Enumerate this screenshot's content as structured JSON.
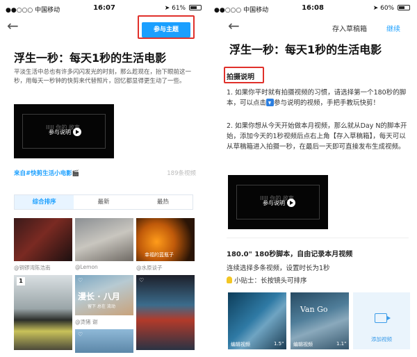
{
  "left": {
    "status": {
      "carrier": "●●○○○ 中国移动",
      "time": "16:07",
      "battery": "61%",
      "battery_level": 0.61
    },
    "nav": {
      "join_label": "参与主题"
    },
    "title": "浮生一秒：每天1秒的生活电影",
    "description": "平淡生活中总也有许多闪闪发光的时刻，那么趁现在，抬下眼前这一秒，用每天一秒钟的快剪来代替照片，回忆都显得更生动了一些。",
    "video": {
      "ghost_text": "IIIII 你的 故事",
      "button_label": "参与说明"
    },
    "source": "来自#快剪生活小电影🎬",
    "count": "189条视频",
    "tabs": [
      {
        "label": "综合排序",
        "active": true
      },
      {
        "label": "最新",
        "active": false
      },
      {
        "label": "最热",
        "active": false
      }
    ],
    "thumbs": {
      "row1_captions": [
        "@铜锣湾陈浩南",
        "@Lemon",
        "@水原谈子"
      ],
      "thumb3_overlay": "幸福的蓝瓶子",
      "thumb4_badge": "1",
      "thumb5_text": "漫长 · 八月",
      "thumb5_sub": "留下 总在 流动",
      "row2_captions": [
        "",
        "@烫猪 谢",
        ""
      ]
    }
  },
  "right": {
    "status": {
      "carrier": "●●○○○ 中国移动",
      "time": "16:08",
      "battery": "60%",
      "battery_level": 0.6
    },
    "nav": {
      "save_draft": "存入草稿箱",
      "continue": "继续"
    },
    "title": "浮生一秒：每天1秒的生活电影",
    "heading": "拍摄说明",
    "step1_a": "1. 如果你平时就有拍摄视频的习惯，请选择第一个180秒的脚本，可以点击",
    "step1_b": "参与说明的视频，手把手教玩快剪！",
    "step2": "2. 如果你想从今天开始做本月视频，那么就从Day N的脚本开始，添加今天的1秒视频后点右上角【存入草稿箱】，每天可以从草稿箱进入拍摄一秒，在最后一天即可直接发布生成视频。",
    "video": {
      "ghost_text": "IIIII 你的 故事",
      "button_label": "参与说明"
    },
    "script_title": "180.0\" 180秒脚本，自由记录本月视频",
    "script_desc": "连续选择多条视频，设置时长为1秒",
    "tip": "小贴士：长按镜头可排序",
    "clips": [
      {
        "label": "编辑视频",
        "duration": "1.5\""
      },
      {
        "label": "编辑视频",
        "duration": "1.1\"",
        "overlay": "Van Go"
      }
    ],
    "add_label": "添加视频"
  }
}
